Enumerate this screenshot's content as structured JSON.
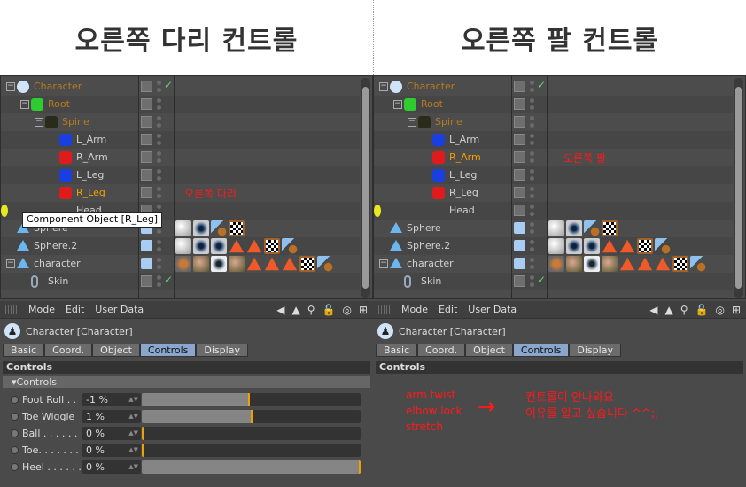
{
  "titles": {
    "left": "오른쪽 다리 컨트롤",
    "right": "오른쪽 팔 컨트롤"
  },
  "colors": {
    "selected_text": "#f3a000",
    "object_text": "#b87a1e",
    "annotation": "#ff1a1a",
    "active_tab": "#8aa6cc"
  },
  "left": {
    "tree": [
      {
        "name": "Character",
        "depth": 0,
        "toggle": "minus",
        "icon": "character-icon",
        "color": "object",
        "check": true
      },
      {
        "name": "Root",
        "depth": 1,
        "toggle": "minus",
        "icon": "root-joint-icon",
        "color": "object"
      },
      {
        "name": "Spine",
        "depth": 2,
        "toggle": "minus",
        "icon": "spine-icon",
        "color": "object"
      },
      {
        "name": "L_Arm",
        "depth": 3,
        "icon": "left-limb-icon"
      },
      {
        "name": "R_Arm",
        "depth": 3,
        "icon": "right-limb-icon"
      },
      {
        "name": "L_Leg",
        "depth": 3,
        "icon": "left-limb-icon"
      },
      {
        "name": "R_Leg",
        "depth": 3,
        "icon": "right-limb-icon",
        "color": "selected"
      },
      {
        "name": "Head",
        "depth": 3,
        "icon": "head-icon"
      },
      {
        "name": "Sphere",
        "depth": 0,
        "icon": "polygon-icon",
        "vis": "blue",
        "tags": [
          "material-white",
          "material-eye",
          "texture-tag",
          "checker-tag"
        ]
      },
      {
        "name": "Sphere.2",
        "depth": 0,
        "icon": "polygon-icon",
        "vis": "blue",
        "tags": [
          "material-white",
          "material-eye",
          "material-eye",
          "triangle-tag",
          "triangle-tag",
          "checker-tag",
          "texture-tag"
        ]
      },
      {
        "name": "character",
        "depth": 0,
        "toggle": "minus",
        "icon": "polygon-icon",
        "vis": "blue",
        "tags": [
          "hair-tag",
          "material-skin",
          "material-eye2",
          "material-skin",
          "triangle-tag",
          "triangle-tag",
          "triangle-tag",
          "checker-tag",
          "texture-tag"
        ]
      },
      {
        "name": "Skin",
        "depth": 1,
        "icon": "skin-icon",
        "check": true
      }
    ],
    "note": "오른쪽 다리",
    "tooltip": "Component Object [R_Leg]",
    "attr": {
      "menu": [
        "Mode",
        "Edit",
        "User Data"
      ],
      "object": "Character [Character]",
      "tabs": [
        "Basic",
        "Coord.",
        "Object",
        "Controls",
        "Display"
      ],
      "active_tab": "Controls",
      "section": "Controls",
      "group": "Controls",
      "controls": [
        {
          "label": "Foot Roll . .",
          "value": "-1 %",
          "level": 0.495
        },
        {
          "label": "Toe Wiggle",
          "value": "1 %",
          "level": 0.505
        },
        {
          "label": "Ball . . . . . . .",
          "value": "0 %",
          "level": 0
        },
        {
          "label": "Toe. . . . . . .",
          "value": "0 %",
          "level": 0
        },
        {
          "label": "Heel . . . . . .",
          "value": "0 %",
          "level": 1
        }
      ]
    }
  },
  "right": {
    "tree": [
      {
        "name": "Character",
        "depth": 0,
        "toggle": "minus",
        "icon": "character-icon",
        "color": "object",
        "check": true
      },
      {
        "name": "Root",
        "depth": 1,
        "toggle": "minus",
        "icon": "root-joint-icon",
        "color": "object"
      },
      {
        "name": "Spine",
        "depth": 2,
        "toggle": "minus",
        "icon": "spine-icon",
        "color": "object"
      },
      {
        "name": "L_Arm",
        "depth": 3,
        "icon": "left-limb-icon"
      },
      {
        "name": "R_Arm",
        "depth": 3,
        "icon": "right-limb-icon",
        "color": "selected"
      },
      {
        "name": "L_Leg",
        "depth": 3,
        "icon": "left-limb-icon"
      },
      {
        "name": "R_Leg",
        "depth": 3,
        "icon": "right-limb-icon"
      },
      {
        "name": "Head",
        "depth": 3,
        "icon": "head-icon"
      },
      {
        "name": "Sphere",
        "depth": 0,
        "icon": "polygon-icon",
        "vis": "blue",
        "tags": [
          "material-white",
          "material-eye",
          "texture-tag",
          "checker-tag"
        ]
      },
      {
        "name": "Sphere.2",
        "depth": 0,
        "icon": "polygon-icon",
        "vis": "blue",
        "tags": [
          "material-white",
          "material-eye",
          "material-eye",
          "triangle-tag",
          "triangle-tag",
          "checker-tag",
          "texture-tag"
        ]
      },
      {
        "name": "character",
        "depth": 0,
        "toggle": "minus",
        "icon": "polygon-icon",
        "vis": "blue",
        "tags": [
          "hair-tag",
          "material-skin",
          "material-eye2",
          "material-skin",
          "triangle-tag",
          "triangle-tag",
          "triangle-tag",
          "checker-tag",
          "texture-tag"
        ]
      },
      {
        "name": "Skin",
        "depth": 1,
        "icon": "skin-icon",
        "check": true
      }
    ],
    "note": "오른쪽 팔",
    "attr": {
      "menu": [
        "Mode",
        "Edit",
        "User Data"
      ],
      "object": "Character [Character]",
      "tabs": [
        "Basic",
        "Coord.",
        "Object",
        "Controls",
        "Display"
      ],
      "active_tab": "Controls",
      "section": "Controls",
      "missing_list": [
        "arm twist",
        "elbow lock",
        "stretch"
      ],
      "arrow": "→",
      "question": [
        "컨트롤이 안나와요",
        "이유를 알고 싶습니다 ^^;;"
      ]
    }
  }
}
